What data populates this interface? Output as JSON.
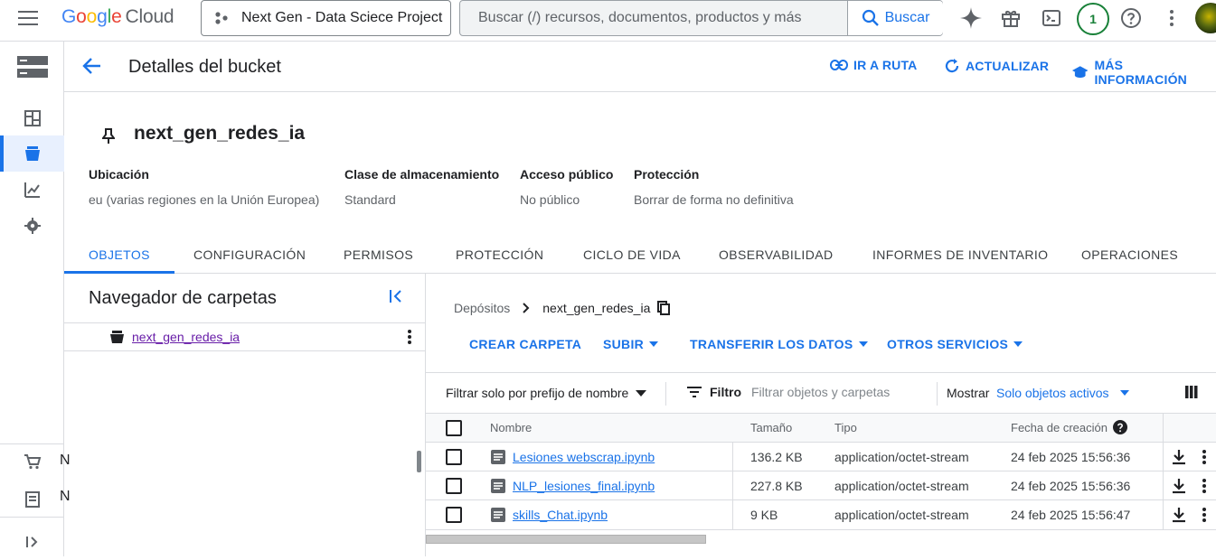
{
  "header": {
    "logo_google": "Google",
    "logo_cloud": "Cloud",
    "project_name": "Next Gen - Data Sciece Project",
    "search_placeholder": "Buscar (/) recursos, documentos, productos y más",
    "search_button": "Buscar",
    "notification_count": "1"
  },
  "left_nav": {
    "partial_label_1": "N",
    "partial_label_2": "N"
  },
  "page": {
    "title": "Detalles del bucket",
    "actions": {
      "go_to_path": "IR A RUTA",
      "refresh": "ACTUALIZAR",
      "more_info": "MÁS INFORMACIÓN"
    }
  },
  "bucket": {
    "name": "next_gen_redes_ia",
    "properties": [
      {
        "label": "Ubicación",
        "value": "eu (varias regiones en la Unión Europea)"
      },
      {
        "label": "Clase de almacenamiento",
        "value": "Standard"
      },
      {
        "label": "Acceso público",
        "value": "No público"
      },
      {
        "label": "Protección",
        "value": "Borrar de forma no definitiva"
      }
    ]
  },
  "tabs": [
    "OBJETOS",
    "CONFIGURACIÓN",
    "PERMISOS",
    "PROTECCIÓN",
    "CICLO DE VIDA",
    "OBSERVABILIDAD",
    "INFORMES DE INVENTARIO",
    "OPERACIONES"
  ],
  "folder_browser": {
    "title": "Navegador de carpetas",
    "item": "next_gen_redes_ia"
  },
  "breadcrumb": {
    "root": "Depósitos",
    "current": "next_gen_redes_ia"
  },
  "object_actions": {
    "create_folder": "CREAR CARPETA",
    "upload": "SUBIR",
    "transfer": "TRANSFERIR LOS DATOS",
    "other": "OTROS SERVICIOS"
  },
  "filter": {
    "prefix": "Filtrar solo por prefijo de nombre",
    "filter_label": "Filtro",
    "filter_placeholder": "Filtrar objetos y carpetas",
    "show_label": "Mostrar",
    "show_value": "Solo objetos activos"
  },
  "table": {
    "columns": [
      "Nombre",
      "Tamaño",
      "Tipo",
      "Fecha de creación"
    ],
    "rows": [
      {
        "name": "Lesiones webscrap.ipynb",
        "size": "136.2 KB",
        "type": "application/octet-stream",
        "created": "24 feb 2025 15:56:36"
      },
      {
        "name": "NLP_lesiones_final.ipynb",
        "size": "227.8 KB",
        "type": "application/octet-stream",
        "created": "24 feb 2025 15:56:36"
      },
      {
        "name": "skills_Chat.ipynb",
        "size": "9 KB",
        "type": "application/octet-stream",
        "created": "24 feb 2025 15:56:47"
      }
    ]
  },
  "colors": {
    "accent": "#1a73e8",
    "visited_link": "#681da8",
    "text": "#202124",
    "muted": "#5f6368",
    "border": "#dadce0"
  }
}
